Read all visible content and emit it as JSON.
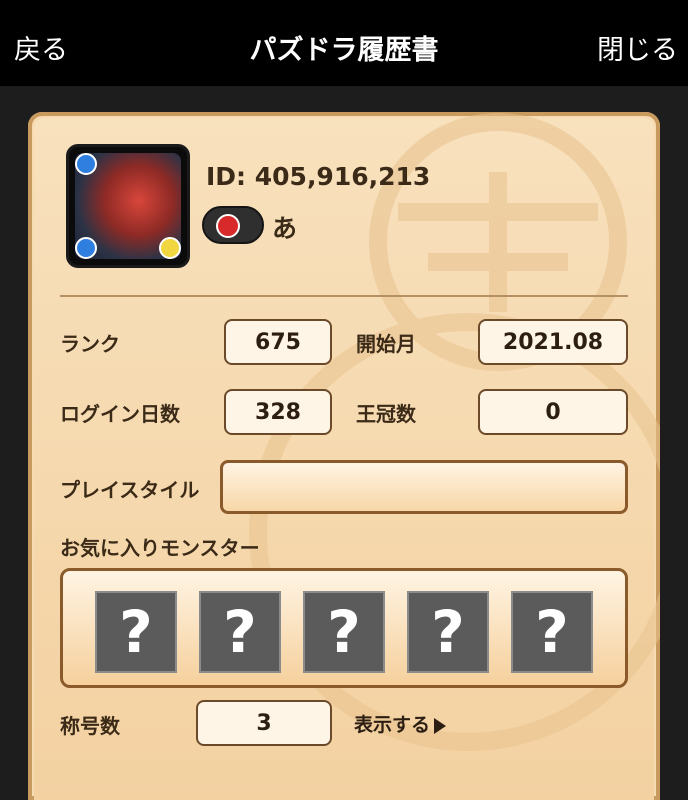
{
  "header": {
    "back_label": "戻る",
    "title": "パズドラ履歴書",
    "close_label": "閉じる"
  },
  "profile": {
    "id_text": "ID: 405,916,213",
    "name": "あ"
  },
  "stats": {
    "rank_label": "ランク",
    "rank_value": "675",
    "start_label": "開始月",
    "start_value": "2021.08",
    "login_label": "ログイン日数",
    "login_value": "328",
    "crown_label": "王冠数",
    "crown_value": "0",
    "playstyle_label": "プレイスタイル",
    "playstyle_value": ""
  },
  "favorites": {
    "label": "お気に入りモンスター",
    "slots": [
      "?",
      "?",
      "?",
      "?",
      "?"
    ]
  },
  "titles": {
    "label": "称号数",
    "value": "3",
    "show_label": "表示する"
  }
}
